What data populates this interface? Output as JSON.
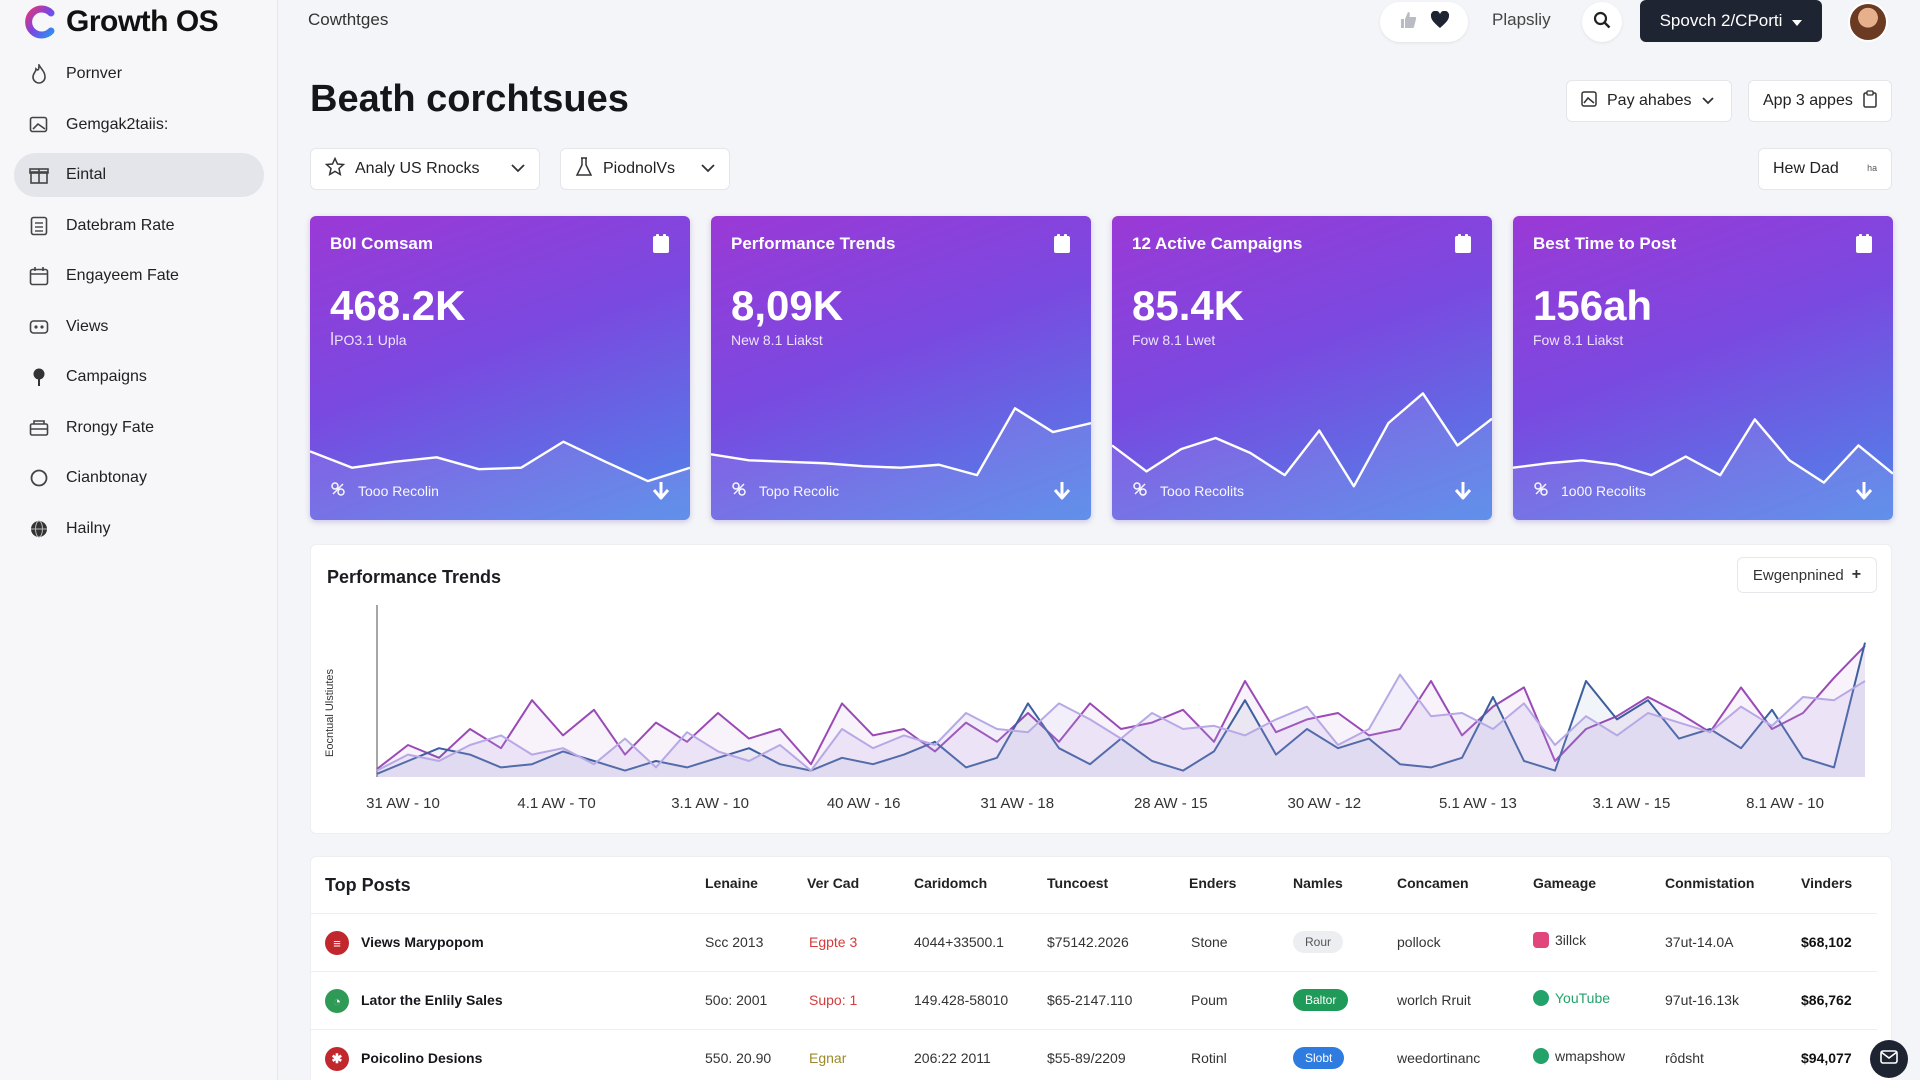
{
  "app": {
    "name": "Growth OS"
  },
  "sidebar": {
    "items": [
      {
        "label": "Pornver",
        "icon": "flame-icon"
      },
      {
        "label": "Gemgak2taiis:",
        "icon": "image-icon"
      },
      {
        "label": "Eintal",
        "icon": "gift-icon",
        "active": true
      },
      {
        "label": "Datebram Rate",
        "icon": "grid-list-icon"
      },
      {
        "label": "Engayeem Fate",
        "icon": "calendar-icon"
      },
      {
        "label": "Views",
        "icon": "gamepad-icon"
      },
      {
        "label": "Campaigns",
        "icon": "pin-icon"
      },
      {
        "label": "Rrongy Fate",
        "icon": "inbox-icon"
      },
      {
        "label": "Cianbtonay",
        "icon": "circle-icon"
      },
      {
        "label": "Hailny",
        "icon": "globe-icon"
      }
    ]
  },
  "header": {
    "breadcrumb": "Cowthtges",
    "play_link": "Plapsliy",
    "primary_button": "Spovch 2/CPorti",
    "title": "Beath corchtsues",
    "pay_button": "Pay ahabes",
    "app_button": "App 3 appes",
    "filter1": "Analy US Rnocks",
    "filter2": "PiodnolVs",
    "hew_button": "Hew Dad",
    "hew_suffix": "ʰᵃ"
  },
  "kpis": [
    {
      "title": "B0I Comsam",
      "value": "468.2K",
      "sub": "ꟾPO3.1 Upla",
      "footer": "Tooo Recolin",
      "trend": [
        52,
        30,
        38,
        44,
        28,
        30,
        65,
        38,
        12,
        30
      ]
    },
    {
      "title": "Performance Trends",
      "value": "8,09K",
      "sub": "New 8.1 Liakst",
      "footer": "Topo Recolic",
      "trend": [
        48,
        40,
        38,
        36,
        32,
        30,
        34,
        20,
        110,
        78,
        90
      ]
    },
    {
      "title": "12 Active Campaigns",
      "value": "85.4K",
      "sub": "Fow 8.1 Lwet",
      "footer": "Tooo Recolits",
      "trend": [
        60,
        25,
        55,
        70,
        50,
        20,
        80,
        5,
        90,
        130,
        60,
        96
      ]
    },
    {
      "title": "Best Time to Post",
      "value": "156ah",
      "sub": "Fow 8.1 Liakst",
      "footer": "1o00 Recolits",
      "trend": [
        30,
        36,
        40,
        34,
        20,
        45,
        20,
        95,
        40,
        10,
        60,
        22
      ]
    }
  ],
  "trends": {
    "title": "Performance Trends",
    "export_button": "Ewgenpnined",
    "y_title": "Eocntual Ulstiutes"
  },
  "chart_data": {
    "type": "area",
    "title": "Performance Trends",
    "xlabel": "",
    "ylabel": "Eocntual Ulstiutes",
    "x": [
      "31 AW - 10",
      "4.1 AW - T0",
      "3.1 AW - 10",
      "40 AW - 16",
      "31 AW - 18",
      "28 AW - 15",
      "30 AW - 12",
      "5.1 AW - 13",
      "3.1 AW - 15",
      "8.1 AW - 10"
    ],
    "ylim": [
      0,
      100
    ],
    "grid": false,
    "series": [
      {
        "color": "#9a4ab6",
        "values": [
          5,
          20,
          12,
          30,
          18,
          48,
          26,
          42,
          14,
          34,
          22,
          40,
          24,
          30,
          8,
          46,
          26,
          30,
          16,
          34,
          22,
          40,
          22,
          46,
          30,
          34,
          42,
          22,
          60,
          28,
          36,
          40,
          26,
          30,
          60,
          26,
          44,
          56,
          10,
          30,
          38,
          50,
          40,
          28,
          56,
          30,
          40,
          62,
          82
        ]
      },
      {
        "color": "#3d5f9e",
        "values": [
          2,
          10,
          18,
          14,
          6,
          8,
          16,
          10,
          4,
          10,
          6,
          12,
          18,
          8,
          4,
          12,
          8,
          14,
          22,
          6,
          12,
          46,
          18,
          8,
          24,
          10,
          4,
          16,
          48,
          14,
          30,
          18,
          24,
          8,
          6,
          12,
          50,
          10,
          4,
          60,
          36,
          48,
          24,
          30,
          18,
          42,
          12,
          6,
          84
        ]
      },
      {
        "color": "#b7a8e6",
        "values": [
          4,
          14,
          10,
          20,
          26,
          14,
          18,
          8,
          24,
          6,
          28,
          16,
          10,
          20,
          4,
          30,
          18,
          26,
          20,
          40,
          30,
          28,
          46,
          36,
          24,
          40,
          30,
          32,
          26,
          36,
          44,
          20,
          30,
          64,
          38,
          40,
          30,
          46,
          20,
          38,
          26,
          40,
          34,
          28,
          44,
          32,
          50,
          48,
          60
        ]
      }
    ]
  },
  "table": {
    "title": "Top Posts",
    "headers": [
      "Lenaine",
      "Ver Cad",
      "Caridomch",
      "Tuncoest",
      "Enders",
      "Namles",
      "Concamen",
      "Gameage",
      "Conmistation",
      "Vinders"
    ],
    "rows": [
      {
        "name": "Views Marypopom",
        "icon_color": "#c0282d",
        "c1": "Scc 2013",
        "c2": "Egpte 3",
        "c2_color": "#d43b3b",
        "c3": "4044+33500.1",
        "c4": "$75142.2026",
        "c5": "Stone",
        "badge": "Rour",
        "badge_bg": "#eceef1",
        "badge_fg": "#555",
        "c7": "pollock",
        "camp": "3illck",
        "camp_color": "#e0457b",
        "c9": "37ut-14.0A",
        "amount": "$68,102"
      },
      {
        "name": "Lator the Enlily Sales",
        "icon_color": "#2e9a55",
        "c1": "50o: 2001",
        "c2": "Supo: 1",
        "c2_color": "#d43b3b",
        "c3": "149.428-58010",
        "c4": "$65-2147.110",
        "c5": "Poum",
        "badge": "Baltor",
        "badge_bg": "#1f9a59",
        "badge_fg": "#fff",
        "c7": "worlch Rruit",
        "camp": "YouTube",
        "camp_color": "#23a36a",
        "c9": "97ut-16.13k",
        "amount": "$86,762"
      },
      {
        "name": "Poicolino Desions",
        "icon_color": "#c0282d",
        "c1": "550. 20.90",
        "c2": "Egnar",
        "c2_color": "#9b8a2a",
        "c3": "206:22 2011",
        "c4": "$55-89/2209",
        "c5": "Rotinl",
        "badge": "Slobt",
        "badge_bg": "#2f7ce0",
        "badge_fg": "#fff",
        "c7": "weedortinanc",
        "camp": "wmapshow",
        "camp_color": "#23a36a",
        "c9": "rôdsht",
        "amount": "$94,077"
      }
    ]
  },
  "colors": {
    "kpi_start": "#9b39d6",
    "kpi_end": "#4f85e8",
    "dark_button": "#1f2432",
    "active_nav": "#e3e5ea"
  }
}
